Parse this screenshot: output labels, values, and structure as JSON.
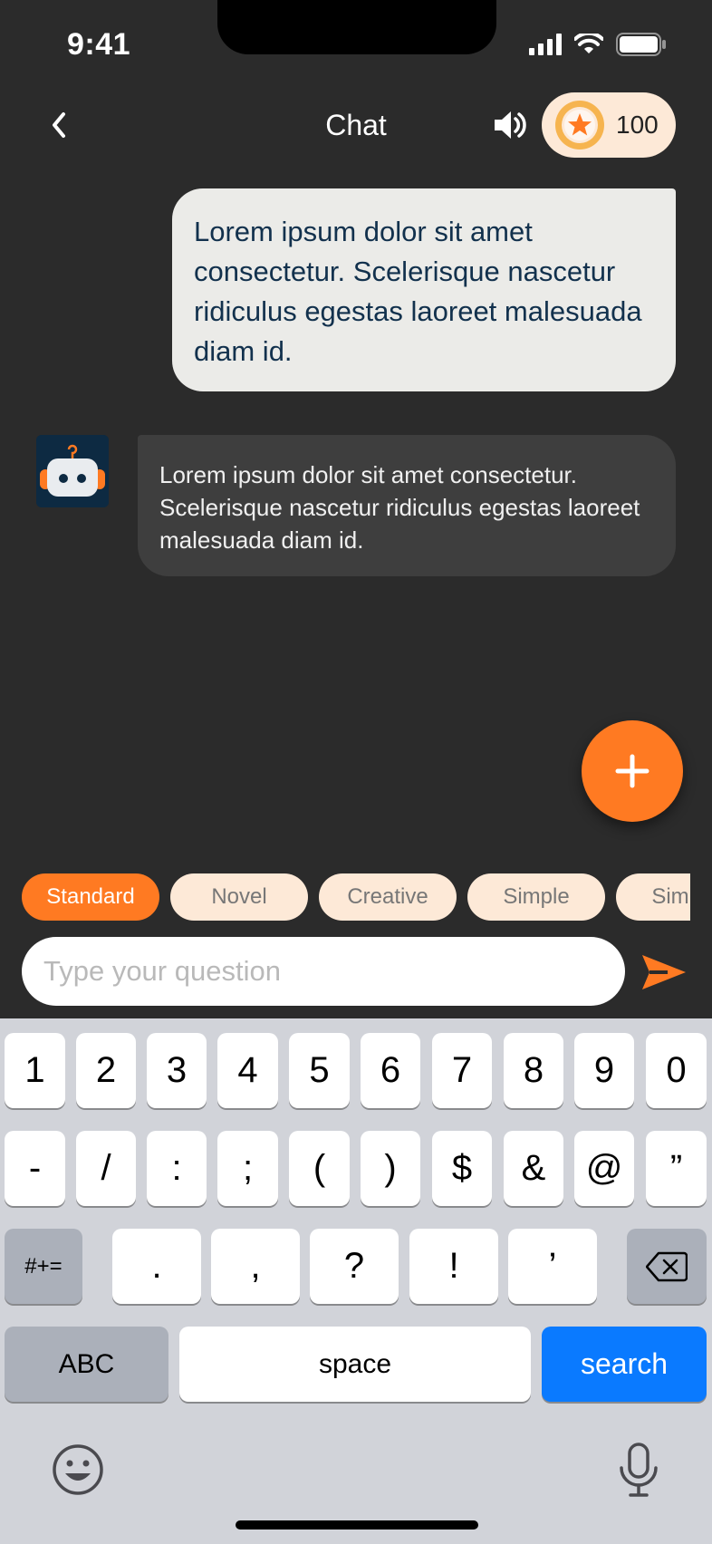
{
  "status": {
    "time": "9:41"
  },
  "header": {
    "title": "Chat",
    "coins": "100"
  },
  "messages": {
    "user": "Lorem ipsum dolor sit amet consectetur. Scelerisque nascetur ridiculus egestas laoreet malesuada diam id.",
    "bot": "Lorem ipsum dolor sit amet consectetur. Scelerisque nascetur ridiculus egestas laoreet malesuada diam id."
  },
  "chips": [
    "Standard",
    "Novel",
    "Creative",
    "Simple",
    "Simple"
  ],
  "active_chip": "Standard",
  "input": {
    "placeholder": "Type your question"
  },
  "keyboard": {
    "row1": [
      "1",
      "2",
      "3",
      "4",
      "5",
      "6",
      "7",
      "8",
      "9",
      "0"
    ],
    "row2": [
      "-",
      "/",
      ":",
      ";",
      "(",
      ")",
      "$",
      "&",
      "@",
      "”"
    ],
    "row3_left": "#+=",
    "row3": [
      ".",
      ",",
      "?",
      "!",
      "’"
    ],
    "abc": "ABC",
    "space": "space",
    "search": "search"
  },
  "colors": {
    "accent": "#ff7a22",
    "background": "#2b2b2b",
    "chip_inactive": "#fde9d7",
    "keyboard_blue": "#0a7aff"
  },
  "icons": [
    "signal-icon",
    "wifi-icon",
    "battery-icon",
    "back-chevron-icon",
    "speaker-icon",
    "coin-star-icon",
    "robot-icon",
    "plus-icon",
    "send-icon",
    "backspace-icon",
    "emoji-icon",
    "microphone-icon"
  ]
}
